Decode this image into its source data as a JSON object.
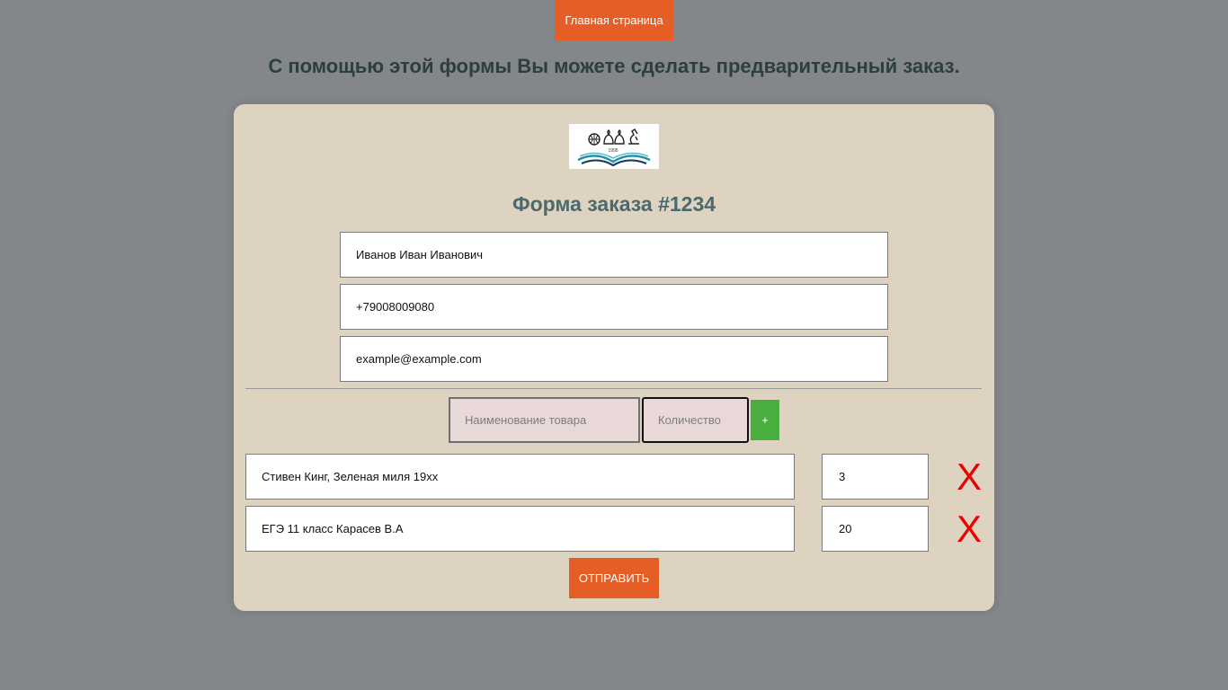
{
  "nav": {
    "home_label": "Главная страница"
  },
  "page": {
    "heading": "С помощью этой формы Вы можете сделать предварительный заказ."
  },
  "form": {
    "title": "Форма заказа #1234",
    "full_name": "Иванов Иван Иванович",
    "phone": "+79008009080",
    "email": "example@example.com"
  },
  "add_item": {
    "name_placeholder": "Наименование товара",
    "qty_placeholder": "Количество",
    "add_label": "+"
  },
  "items": [
    {
      "name": "Стивен Кинг, Зеленая миля 19xx",
      "qty": "3",
      "remove_label": "X"
    },
    {
      "name": "ЕГЭ 11 класс Карасев В.А",
      "qty": "20",
      "remove_label": "X"
    }
  ],
  "submit_label": "ОТПРАВИТЬ",
  "logo": {
    "year_text": "1995",
    "icon": "open-book-science-logo"
  },
  "colors": {
    "background": "#84878a",
    "accent": "#e45e25",
    "card": "#ded2c1",
    "add_button": "#48ae3e",
    "remove": "#ec0000",
    "title": "#4b6a6e"
  }
}
